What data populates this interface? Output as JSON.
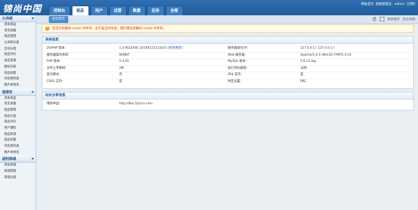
{
  "app": {
    "logo_text": "锦尚中国",
    "nav_tabs": [
      "控制台",
      "商品",
      "用户",
      "运营",
      "数据",
      "应用",
      "全局"
    ],
    "active_tab_index": 1,
    "top_links": [
      "网站首页",
      "超级管理员：admin",
      "[注销]"
    ]
  },
  "subheader": {
    "active_subtab": "后台首页",
    "tools": [
      "更新缓存",
      "后台地图"
    ]
  },
  "sidebar": {
    "groups": [
      {
        "title": "九块邮",
        "items": [
          "添加商品",
          "淘宝采集",
          "商品管理",
          "九块邮分类",
          "自动分类",
          "商品评论",
          "商品来源",
          "图标列表",
          "商品采集",
          "待处理列表",
          "图片本地化"
        ]
      },
      {
        "title": "值得买",
        "items": [
          "添加商品",
          "淘宝采集",
          "商品管理",
          "商品分类",
          "商品评论",
          "用户爆料",
          "商品来源",
          "商品采集",
          "待处理列表",
          "图片本地化"
        ]
      },
      {
        "title": "返利商城",
        "items": [
          "添加商城",
          "商城管理",
          "商城分类"
        ]
      }
    ]
  },
  "notice": {
    "text": "您还没有删除 install 文件夹，出于安全的考虑，我们建议您删除 install 文件夹。"
  },
  "system_info": {
    "title": "系统信息",
    "rows": [
      {
        "l1": "ZhiPHP 版本：",
        "v1": "1.4 RELEASE 20140115133143",
        "v1_link": "[检查更新]",
        "l2": "服务器域名/IP：",
        "v2": "127.0.0.1 [ 127.0.0.1 ]"
      },
      {
        "l1": "服务器操作系统：",
        "v1": "WINNT",
        "v1_link": "",
        "l2": "Web 服务器：",
        "v2": "Apache/2.4.4 (Win32) PHP/5.4.16"
      },
      {
        "l1": "PHP 版本：",
        "v1": "5.4.16",
        "v1_link": "",
        "l2": "MySQL 版本：",
        "v2": "5.6.12-log"
      },
      {
        "l1": "文件上传限制：",
        "v1": "2M",
        "v1_link": "",
        "l2": "执行时间限制：",
        "v2": "30秒"
      },
      {
        "l1": "安全模式：",
        "v1": "否",
        "v1_link": "",
        "l2": "Zlib 支持：",
        "v2": "是"
      },
      {
        "l1": "CURL 支持：",
        "v1": "是",
        "v1_link": "",
        "l2": "时区设置：",
        "v2": "PRC"
      }
    ]
  },
  "site_info": {
    "title": "站长分享信息",
    "rows": [
      {
        "l1": "锦尚中国：",
        "v1": "http://bbs.52jscn.com"
      }
    ]
  },
  "colors": {
    "brand": "#215c99",
    "warning_text": "#d32f2f",
    "link": "#1a56c7"
  }
}
